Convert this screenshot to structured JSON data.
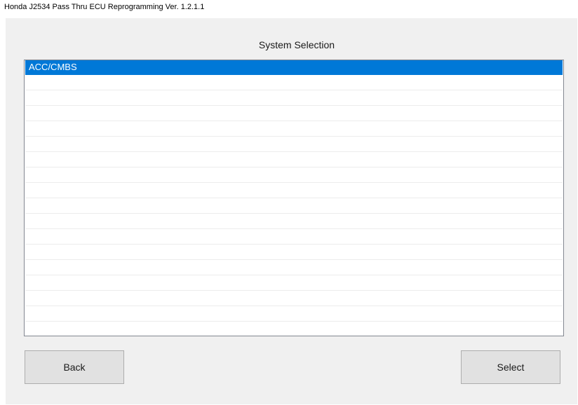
{
  "window": {
    "title": "Honda J2534 Pass Thru ECU Reprogramming Ver. 1.2.1.1"
  },
  "main": {
    "heading": "System Selection",
    "list": {
      "items": [
        {
          "label": "ACC/CMBS",
          "selected": true
        }
      ]
    },
    "buttons": {
      "back_label": "Back",
      "select_label": "Select"
    }
  },
  "colors": {
    "selection": "#0078d7",
    "window_background": "#f0f0f0",
    "button_face": "#e1e1e1"
  }
}
